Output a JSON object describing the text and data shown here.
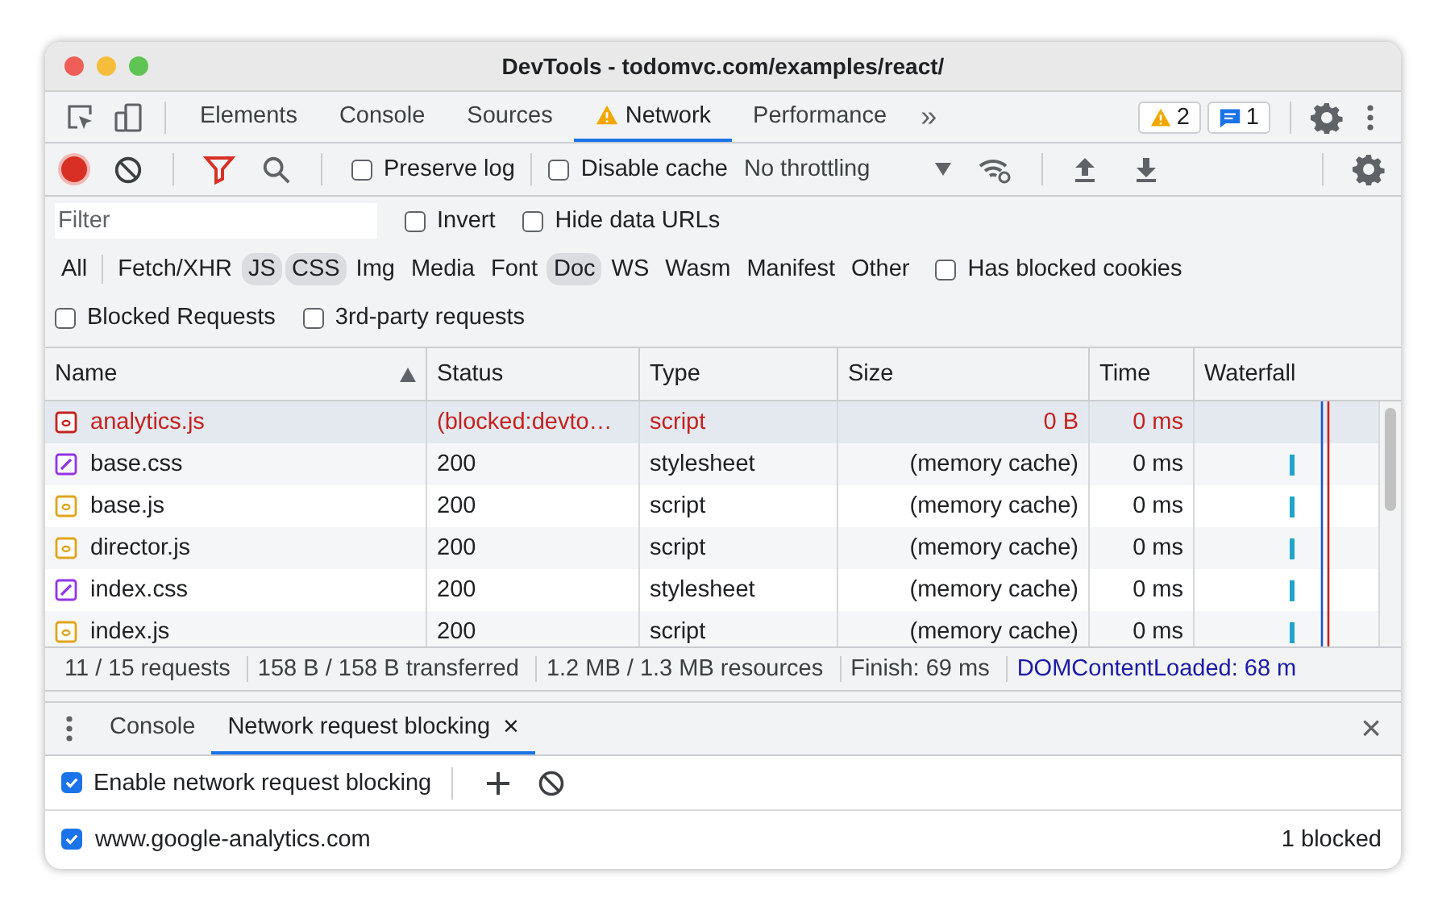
{
  "window": {
    "title": "DevTools - todomvc.com/examples/react/"
  },
  "tabs": [
    {
      "label": "Elements",
      "selected": false,
      "warning": false
    },
    {
      "label": "Console",
      "selected": false,
      "warning": false
    },
    {
      "label": "Sources",
      "selected": false,
      "warning": false
    },
    {
      "label": "Network",
      "selected": true,
      "warning": true
    },
    {
      "label": "Performance",
      "selected": false,
      "warning": false
    }
  ],
  "more_tabs": "»",
  "badges": [
    {
      "kind": "warning",
      "count": "2"
    },
    {
      "kind": "message",
      "count": "1"
    }
  ],
  "toolbar": {
    "recording": true,
    "filter_active": true,
    "checkboxes": [
      {
        "label": "Preserve log",
        "checked": false
      },
      {
        "label": "Disable cache",
        "checked": false
      }
    ],
    "throttling": "No throttling"
  },
  "filter": {
    "placeholder": "Filter",
    "options": [
      {
        "label": "Invert",
        "checked": false
      },
      {
        "label": "Hide data URLs",
        "checked": false
      }
    ],
    "types": [
      {
        "label": "All",
        "selected": false
      },
      {
        "label": "Fetch/XHR",
        "selected": false
      },
      {
        "label": "JS",
        "selected": true
      },
      {
        "label": "CSS",
        "selected": true
      },
      {
        "label": "Img",
        "selected": false
      },
      {
        "label": "Media",
        "selected": false
      },
      {
        "label": "Font",
        "selected": false
      },
      {
        "label": "Doc",
        "selected": true
      },
      {
        "label": "WS",
        "selected": false
      },
      {
        "label": "Wasm",
        "selected": false
      },
      {
        "label": "Manifest",
        "selected": false
      },
      {
        "label": "Other",
        "selected": false
      }
    ],
    "blocked_cookies": {
      "label": "Has blocked cookies",
      "checked": false
    },
    "more_options": [
      {
        "label": "Blocked Requests",
        "checked": false
      },
      {
        "label": "3rd-party requests",
        "checked": false
      }
    ]
  },
  "table": {
    "columns": [
      {
        "label": "Name",
        "sorted": true
      },
      {
        "label": "Status",
        "sorted": false
      },
      {
        "label": "Type",
        "sorted": false
      },
      {
        "label": "Size",
        "sorted": false
      },
      {
        "label": "Time",
        "sorted": false
      },
      {
        "label": "Waterfall",
        "sorted": false
      }
    ],
    "rows": [
      {
        "kind": "script",
        "name": "analytics.js",
        "status": "(blocked:devto…",
        "type": "script",
        "size": "0 B",
        "time": "0 ms",
        "blocked": true,
        "hovered": true
      },
      {
        "kind": "stylesheet",
        "name": "base.css",
        "status": "200",
        "type": "stylesheet",
        "size": "(memory cache)",
        "time": "0 ms",
        "blocked": false,
        "hovered": false
      },
      {
        "kind": "script",
        "name": "base.js",
        "status": "200",
        "type": "script",
        "size": "(memory cache)",
        "time": "0 ms",
        "blocked": false,
        "hovered": false
      },
      {
        "kind": "script",
        "name": "director.js",
        "status": "200",
        "type": "script",
        "size": "(memory cache)",
        "time": "0 ms",
        "blocked": false,
        "hovered": false
      },
      {
        "kind": "stylesheet",
        "name": "index.css",
        "status": "200",
        "type": "stylesheet",
        "size": "(memory cache)",
        "time": "0 ms",
        "blocked": false,
        "hovered": false
      },
      {
        "kind": "script",
        "name": "index.js",
        "status": "200",
        "type": "script",
        "size": "(memory cache)",
        "time": "0 ms",
        "blocked": false,
        "hovered": false
      }
    ]
  },
  "status_bar": [
    {
      "kind": "plain",
      "text": "11 / 15 requests"
    },
    {
      "kind": "plain",
      "text": "158 B / 158 B transferred"
    },
    {
      "kind": "plain",
      "text": "1.2 MB / 1.3 MB resources"
    },
    {
      "kind": "plain",
      "text": "Finish: 69 ms"
    },
    {
      "kind": "dom",
      "text": "DOMContentLoaded: 68 m"
    }
  ],
  "drawer": {
    "tabs": [
      {
        "label": "Console",
        "selected": false,
        "closable": false
      },
      {
        "label": "Network request blocking",
        "selected": true,
        "closable": true
      }
    ],
    "close": "×",
    "enable": {
      "label": "Enable network request blocking",
      "checked": true
    },
    "patterns": [
      {
        "pattern": "www.google-analytics.com",
        "checked": true,
        "count": "1 blocked"
      }
    ]
  }
}
